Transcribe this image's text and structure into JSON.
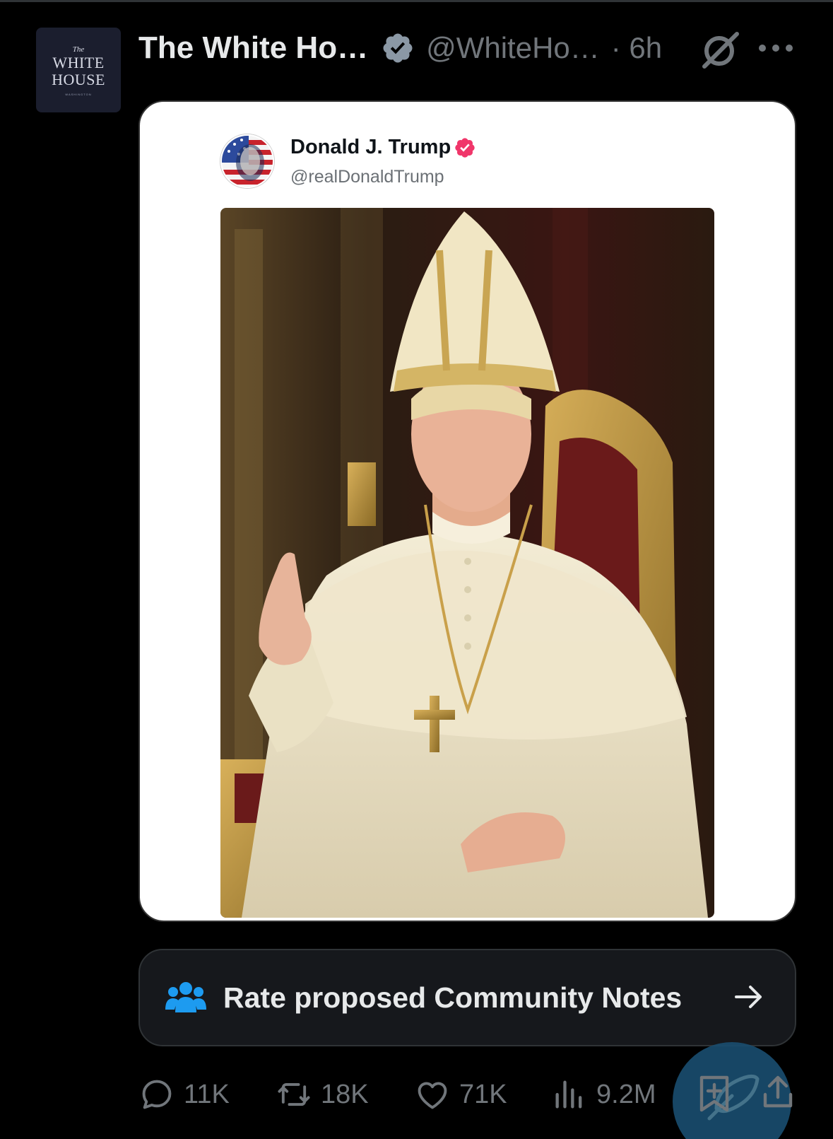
{
  "post": {
    "author": {
      "avatar_text_small": "The",
      "avatar_text_line1": "WHITE",
      "avatar_text_line2": "HOUSE",
      "avatar_text_tiny": "WASHINGTON",
      "display_name": "The White Ho…",
      "handle": "@WhiteHo…",
      "time": "· 6h",
      "verified_icon": "verified-badge-icon",
      "verified_color": "#8b98a5"
    },
    "grok_icon": "grok-icon",
    "more_icon": "more-icon"
  },
  "quoted": {
    "name": "Donald J. Trump",
    "handle": "@realDonaldTrump",
    "verified_color": "#f0366a",
    "image_icon": "photo-image"
  },
  "community_notes": {
    "label": "Rate proposed Community Notes",
    "icon": "people-icon",
    "icon_color": "#1d9bf0",
    "arrow_icon": "arrow-right-icon"
  },
  "actions": {
    "replies": "11K",
    "reposts": "18K",
    "likes": "71K",
    "views": "9.2M"
  },
  "colors": {
    "background": "#000000",
    "text_primary": "#e7e9ea",
    "text_secondary": "#71767b",
    "accent": "#1d9bf0"
  }
}
